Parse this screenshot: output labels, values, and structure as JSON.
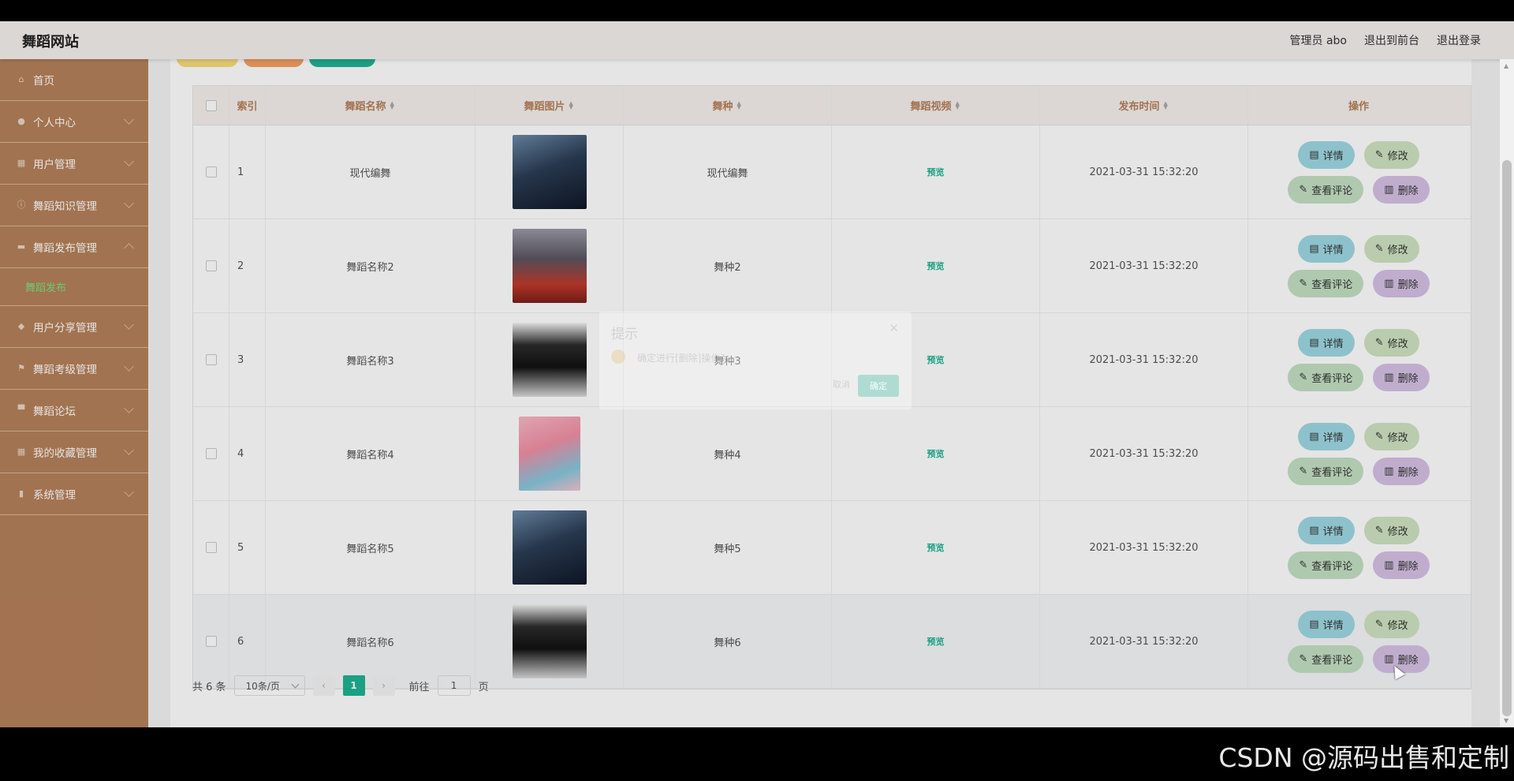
{
  "brand": "舞蹈网站",
  "top_nav": [
    "管理员 abo",
    "退出到前台",
    "退出登录"
  ],
  "sidebar": {
    "items": [
      {
        "label": "首页",
        "icon": "home-icon"
      },
      {
        "label": "个人中心",
        "icon": "user-icon"
      },
      {
        "label": "用户管理",
        "icon": "grid-icon"
      },
      {
        "label": "舞蹈知识管理",
        "icon": "info-icon"
      },
      {
        "label": "舞蹈发布管理",
        "icon": "folder-icon"
      },
      {
        "label": "舞蹈发布",
        "sub": true
      },
      {
        "label": "用户分享管理",
        "icon": "map-pin-icon"
      },
      {
        "label": "舞蹈考级管理",
        "icon": "flag-icon"
      },
      {
        "label": "舞蹈论坛",
        "icon": "chat-icon"
      },
      {
        "label": "我的收藏管理",
        "icon": "grid-icon"
      },
      {
        "label": "系统管理",
        "icon": "mic-icon"
      }
    ]
  },
  "table": {
    "headers": [
      "索引",
      "舞蹈名称",
      "舞蹈图片",
      "舞种",
      "舞蹈视频",
      "发布时间",
      "操作"
    ],
    "rows": [
      {
        "index": "1",
        "name": "现代编舞",
        "type": "现代编舞",
        "video": "预览",
        "time": "2021-03-31 15:32:20"
      },
      {
        "index": "2",
        "name": "舞蹈名称2",
        "type": "舞种2",
        "video": "预览",
        "time": "2021-03-31 15:32:20"
      },
      {
        "index": "3",
        "name": "舞蹈名称3",
        "type": "舞种3",
        "video": "预览",
        "time": "2021-03-31 15:32:20"
      },
      {
        "index": "4",
        "name": "舞蹈名称4",
        "type": "舞种4",
        "video": "预览",
        "time": "2021-03-31 15:32:20"
      },
      {
        "index": "5",
        "name": "舞蹈名称5",
        "type": "舞种5",
        "video": "预览",
        "time": "2021-03-31 15:32:20"
      },
      {
        "index": "6",
        "name": "舞蹈名称6",
        "type": "舞种6",
        "video": "预览",
        "time": "2021-03-31 15:32:20"
      }
    ],
    "actions": {
      "detail": "详情",
      "edit": "修改",
      "review": "查看评论",
      "delete": "删除"
    }
  },
  "pagination": {
    "total": "共 6 条",
    "page_size": "10条/页",
    "current": "1",
    "goto_label": "前往",
    "goto_value": "1",
    "page_unit": "页"
  },
  "dialog": {
    "title": "提示",
    "message": "确定进行[删除]操作?",
    "cancel": "取消",
    "confirm": "确定"
  },
  "watermark": "CSDN @源码出售和定制",
  "colors": {
    "sidebar": "#b5805a",
    "accent": "#1fb393"
  }
}
